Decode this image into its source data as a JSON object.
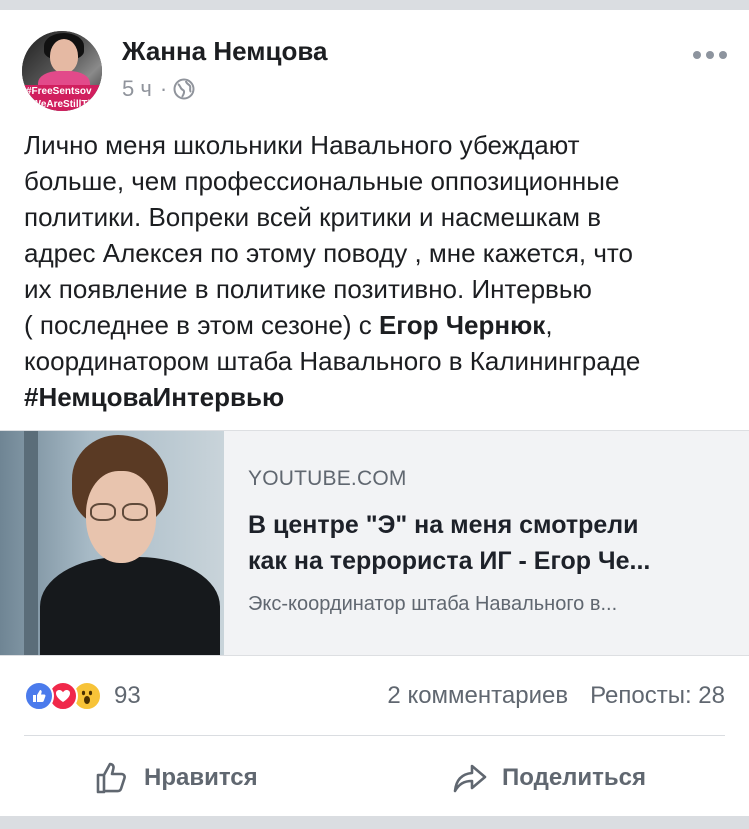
{
  "post": {
    "author": "Жанна Немцова",
    "time": "5 ч",
    "separator": "·",
    "privacy_icon": "globe-icon",
    "avatar_banner_line1": "#FreeSentsov",
    "avatar_banner_line2": "#WeAreStillThere",
    "text": {
      "line1": "Лично меня школьники Навального убеждают",
      "line2": "больше, чем профессиональные оппозиционные",
      "line3": "политики. Вопреки всей критики и насмешкам в",
      "line4": "адрес Алексея по этому поводу , мне кажется, что",
      "line5": "их появление в политике позитивно. Интервью",
      "line6_pre": "( последнее в этом сезоне) с ",
      "line6_mention": "Егор Чернюк",
      "line6_post": ",",
      "line7": "координатором штаба Навального в Калининграде",
      "hashtag": "#НемцоваИнтервью"
    }
  },
  "link_preview": {
    "domain": "YOUTUBE.COM",
    "title_line1": "В центре \"Э\" на меня смотрели",
    "title_line2": "как на террориста ИГ - Егор Че...",
    "description": "Экс-координатор штаба Навального в..."
  },
  "engagement": {
    "reactions_count": "93",
    "reaction_icons": [
      "like-icon",
      "love-icon",
      "wow-icon"
    ],
    "comments": "2 комментариев",
    "shares": "Репосты: 28"
  },
  "actions": {
    "like_label": "Нравится",
    "share_label": "Поделиться"
  },
  "colors": {
    "like": "#4b7bec",
    "love": "#f0284a",
    "wow": "#f7c338",
    "secondary_text": "#606770"
  }
}
